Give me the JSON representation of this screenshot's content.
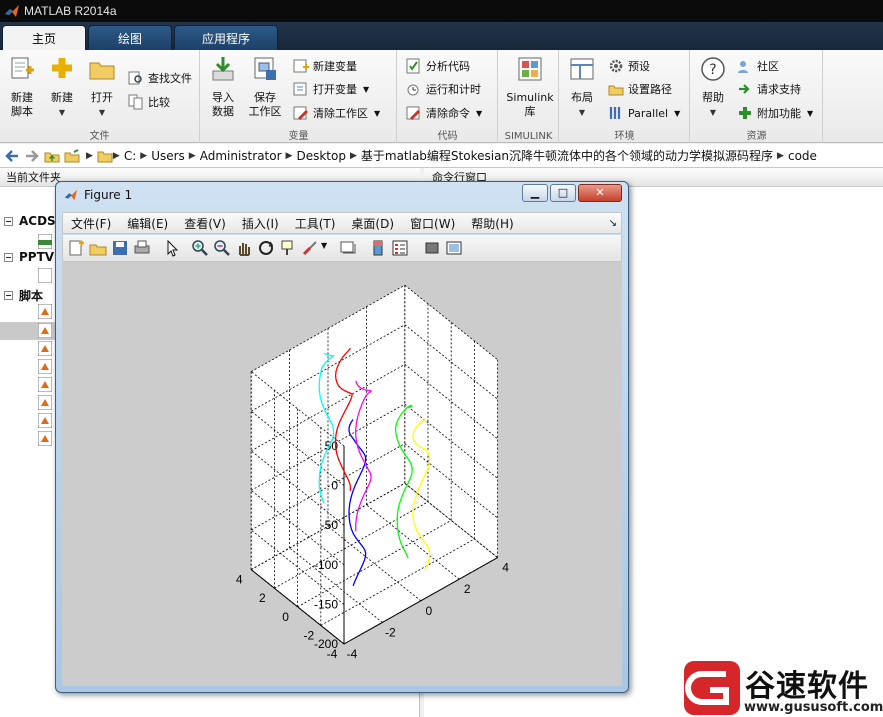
{
  "app": {
    "title": "MATLAB R2014a",
    "tabs": [
      "主页",
      "绘图",
      "应用程序"
    ]
  },
  "ribbon": {
    "file_group": {
      "label": "文件",
      "new_script": "新建\n脚本",
      "new": "新建",
      "open": "打开",
      "find_files": "查找文件",
      "compare": "比较"
    },
    "variable_group": {
      "label": "变量",
      "import_data": "导入\n数据",
      "save_workspace": "保存\n工作区",
      "new_variable": "新建变量",
      "open_variable": "打开变量",
      "clear_workspace": "清除工作区"
    },
    "code_group": {
      "label": "代码",
      "analyze_code": "分析代码",
      "run_and_time": "运行和计时",
      "clear_commands": "清除命令"
    },
    "simulink_group": {
      "label": "SIMULINK",
      "simulink_library": "Simulink\n库"
    },
    "environment_group": {
      "label": "环境",
      "layout": "布局",
      "preferences": "预设",
      "set_path": "设置路径",
      "parallel": "Parallel"
    },
    "resources_group": {
      "label": "资源",
      "help": "帮助",
      "community": "社区",
      "request_support": "请求支持",
      "addons": "附加功能"
    }
  },
  "address": {
    "crumbs": [
      "C:",
      "Users",
      "Administrator",
      "Desktop",
      "基于matlab编程Stokesian沉降牛顿流体中的各个领域的动力学模拟源码程序",
      "code"
    ]
  },
  "left_panel": {
    "header": "当前文件夹",
    "tree": [
      "ACDS",
      "PPTV",
      "脚本"
    ]
  },
  "right_panel": {
    "header": "命令行窗口"
  },
  "figure": {
    "title": "Figure 1",
    "menus": [
      "文件(F)",
      "编辑(E)",
      "查看(V)",
      "插入(I)",
      "工具(T)",
      "桌面(D)",
      "窗口(W)",
      "帮助(H)"
    ],
    "buttons": {
      "minimize": "▁",
      "maximize": "□",
      "close": "✕"
    }
  },
  "chart_data": {
    "type": "line",
    "plot_style": "3d",
    "grid": true,
    "z_ticks": [
      50,
      0,
      -50,
      -100,
      -150,
      -200
    ],
    "z_lim": [
      -200,
      50
    ],
    "x_ticks": [
      4,
      2,
      0,
      -2,
      -4
    ],
    "x_lim": [
      -4,
      4
    ],
    "y_ticks": [
      4,
      2,
      0,
      -2,
      -4
    ],
    "y_lim": [
      -4,
      4
    ],
    "series_colors": [
      "#0000ff",
      "#ffff00",
      "#ff0000",
      "#00ff00",
      "#00ffff",
      "#ff00ff"
    ],
    "series": [
      {
        "color": "#0000ff",
        "x": [
          -1.5,
          -1.4,
          -1.6,
          -1.5,
          -1.4,
          -1.6,
          -1.5
        ],
        "y": [
          -1.0,
          -0.9,
          -1.1,
          -1.0,
          -0.9,
          -1.1,
          -1.0
        ],
        "z": [
          -200,
          -160,
          -120,
          -80,
          -40,
          0,
          10
        ]
      },
      {
        "color": "#ffff00",
        "x": [
          1.0,
          1.1,
          0.9,
          1.0,
          1.1,
          0.9,
          1.0
        ],
        "y": [
          -2.4,
          -2.3,
          -2.5,
          -2.4,
          -2.3,
          -2.5,
          -2.4
        ],
        "z": [
          -200,
          -160,
          -120,
          -80,
          -40,
          -20,
          -10
        ]
      },
      {
        "color": "#ff0000",
        "x": [
          -1.3,
          -1.2,
          -1.3,
          -1.2,
          -1.3,
          -1.2,
          -1.3
        ],
        "y": [
          0.6,
          0.6,
          0.6,
          0.6,
          0.6,
          0.6,
          0.6
        ],
        "z": [
          -100,
          -60,
          -20,
          20,
          40,
          60,
          80
        ]
      },
      {
        "color": "#00ff00",
        "x": [
          1.2,
          1.3,
          1.2,
          1.3,
          1.2,
          1.3,
          1.2
        ],
        "y": [
          -0.5,
          -0.5,
          -0.5,
          -0.5,
          -0.5,
          -0.5,
          -0.5
        ],
        "z": [
          -200,
          -160,
          -120,
          -80,
          -40,
          -20,
          -10
        ]
      },
      {
        "color": "#00ffff",
        "x": [
          -0.8,
          -0.7,
          -0.9,
          -0.8,
          -0.7,
          -0.9,
          -0.8
        ],
        "y": [
          2.8,
          2.9,
          2.7,
          2.8,
          2.9,
          2.7,
          2.8
        ],
        "z": [
          -140,
          -100,
          -60,
          -20,
          20,
          40,
          50
        ]
      },
      {
        "color": "#ff00ff",
        "x": [
          1.0,
          1.1,
          0.9,
          1.0,
          1.1,
          0.9,
          1.0
        ],
        "y": [
          2.6,
          2.7,
          2.5,
          2.6,
          2.7,
          2.5,
          2.6
        ],
        "z": [
          -200,
          -160,
          -120,
          -80,
          -40,
          -20,
          -10
        ]
      }
    ]
  },
  "watermark": {
    "text": "谷速软件",
    "url": "www.gususoft.com"
  }
}
